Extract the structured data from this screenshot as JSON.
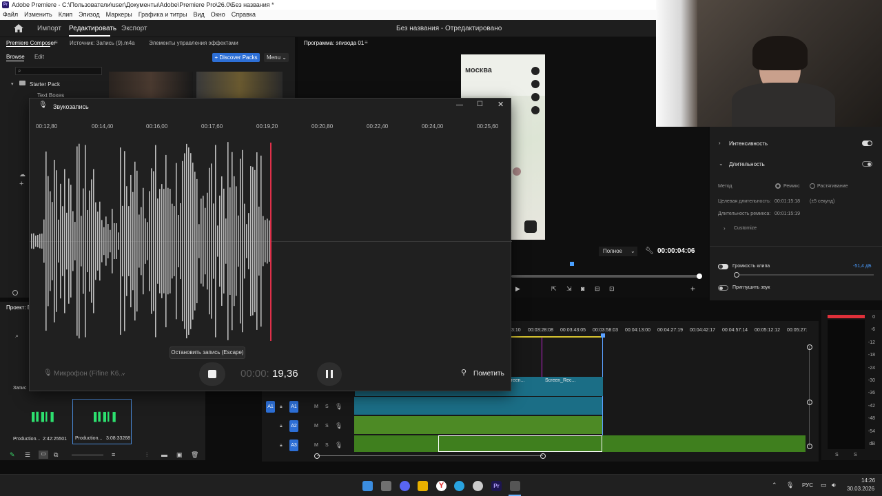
{
  "window": {
    "title": "Adobe Premiere - C:\\Пользователи\\user\\Документы\\Adobe\\Premiere Pro\\26.0\\Без названия *",
    "app_badge": "Pr"
  },
  "menu": [
    "Файл",
    "Изменить",
    "Клип",
    "Эпизод",
    "Маркеры",
    "Графика и титры",
    "Вид",
    "Окно",
    "Справка"
  ],
  "header": {
    "tabs": [
      "Импорт",
      "Редактировать",
      "Экспорт"
    ],
    "active_tab": "Редактировать",
    "project_title": "Без названия - Отредактировано"
  },
  "left_panel": {
    "tabs": [
      "Premiere Composer",
      "Источник: Запись (9).m4a",
      "Элементы управления эффектами"
    ],
    "subtabs": [
      "Browse",
      "Edit"
    ],
    "discover_button": "+ Discover Packs",
    "menu_button": "Menu",
    "tree": [
      {
        "label": "Starter Pack"
      },
      {
        "label": "Text Boxes"
      }
    ]
  },
  "program_monitor": {
    "title": "Программа: эпизода 01",
    "map_city": "москва",
    "zoom": "Полное",
    "timecode": "00:00:04:06"
  },
  "effects_panel": {
    "intensity_label": "Интенсивность",
    "duration_label": "Длительность",
    "method_label": "Метод",
    "method_options": [
      "Ремикс",
      "Растягивание"
    ],
    "target_duration_label": "Целевая длительность:",
    "target_duration": "00:01:15:18",
    "target_duration_note": "(±5 секунд)",
    "remix_duration_label": "Длительность ремикса:",
    "remix_duration": "00:01:15:19",
    "customize": "Customize",
    "clip_volume_label": "Громкость клипа",
    "clip_volume": "-51,4 дБ",
    "mute_label": "Приглушить звук"
  },
  "project_panel": {
    "title": "Проект: Бе",
    "items": [
      {
        "name": "Production...",
        "duration": "2:42:25501"
      },
      {
        "name": "Production...",
        "duration": "3:08:33268"
      }
    ],
    "record_label": "Запис"
  },
  "recorder": {
    "title": "Звукозапись",
    "ruler": [
      "00:12,80",
      "00:14,40",
      "00:16,00",
      "00:17,60",
      "00:19,20",
      "00:20,80",
      "00:22,40",
      "00:24,00",
      "00:25,60"
    ],
    "tooltip": "Остановить запись (Escape)",
    "microphone": "Микрофон (Fifine K6...",
    "elapsed_dim": "00:00:",
    "elapsed": "19,36",
    "mark_button": "Пометить"
  },
  "timeline": {
    "ruler": [
      "3:10",
      "00:03:28:08",
      "00:03:43:05",
      "00:03:58:03",
      "00:04:13:00",
      "00:04:27:19",
      "00:04:42:17",
      "00:04:57:14",
      "00:05:12:12",
      "00:05:27:"
    ],
    "clip_label": "Screen_Rec...",
    "clip_label_prev": "creen...",
    "tracks": [
      {
        "source": "A1",
        "label": "A1",
        "m": "M",
        "s": "S"
      },
      {
        "label": "A2",
        "m": "M",
        "s": "S"
      },
      {
        "label": "A3",
        "m": "M",
        "s": "S"
      }
    ]
  },
  "meters": {
    "scale": [
      "0",
      "-6",
      "-12",
      "-18",
      "-24",
      "-30",
      "-36",
      "-42",
      "-48",
      "-54",
      "dB"
    ],
    "channels": [
      "S",
      "S"
    ]
  },
  "taskbar": {
    "lang": "РУС",
    "time": "14:26",
    "date": "30.03.2026",
    "pr_label": "Pr"
  },
  "colors": {
    "accent": "#2d6fd6",
    "playhead": "#e0304a",
    "audio_green": "#5a9a2a",
    "audio_teal": "#1b7e96"
  }
}
